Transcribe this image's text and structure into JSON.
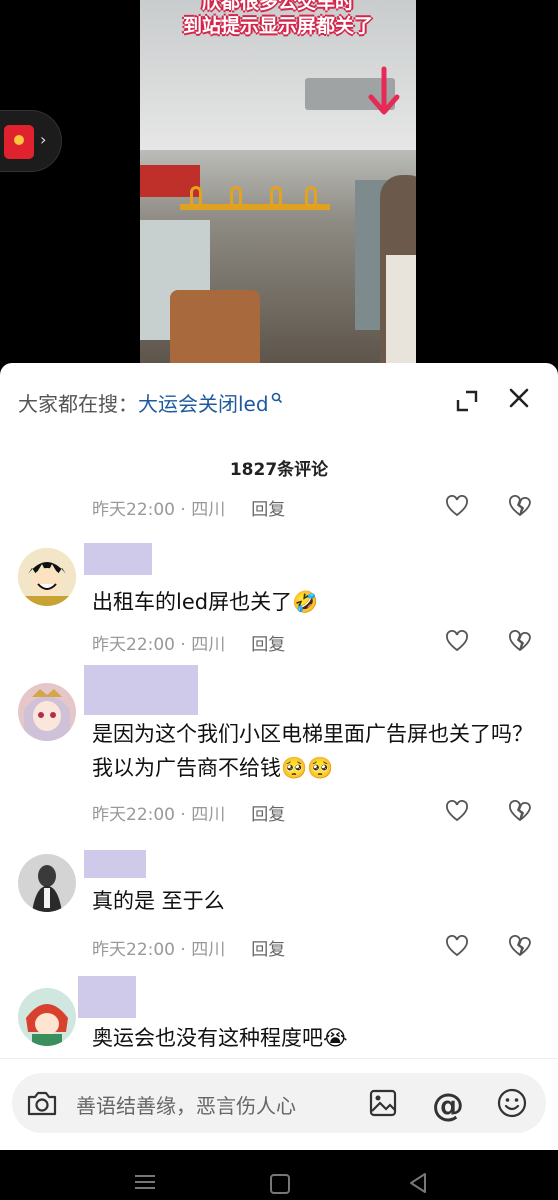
{
  "video": {
    "caption_line1": "欣都很多公交车时",
    "caption_line2": "到站提示显示屏都关了"
  },
  "search_bar": {
    "prefix": "大家都在搜：",
    "term": "大运会关闭led"
  },
  "comments_header": {
    "count_label": "1827条评论"
  },
  "comments": [
    {
      "text": "",
      "time": "昨天22:00 · 四川",
      "reply_label": "回复"
    },
    {
      "text": "出租车的led屏也关了🤣",
      "time": "昨天22:00 · 四川",
      "reply_label": "回复"
    },
    {
      "text": "是因为这个我们小区电梯里面广告屏也关了吗？我以为广告商不给钱🥺🥺",
      "time": "昨天22:00 · 四川",
      "reply_label": "回复"
    },
    {
      "text": "真的是 至于么",
      "time": "昨天22:00 · 四川",
      "reply_label": "回复"
    },
    {
      "text": "奥运会也没有这种程度吧😭",
      "time": "",
      "reply_label": ""
    }
  ],
  "input_bar": {
    "placeholder": "善语结善缘，恶言伤人心"
  },
  "colors": {
    "link_blue": "#1d5a9e",
    "name_placeholder": "#cfc9ea",
    "meta_gray": "#999999",
    "caption_outline": "#d4254a"
  },
  "icons": [
    "redpacket-icon",
    "arrow-down-icon",
    "search-icon",
    "expand-icon",
    "close-icon",
    "heart-icon",
    "broken-heart-icon",
    "camera-icon",
    "image-icon",
    "at-icon",
    "emoji-icon",
    "menu-icon",
    "home-icon",
    "back-icon"
  ]
}
